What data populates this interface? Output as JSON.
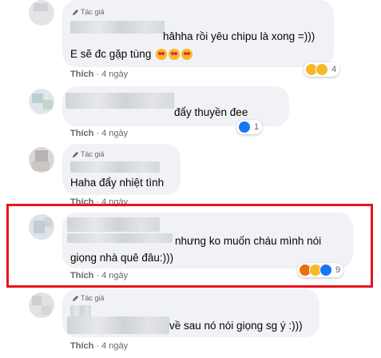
{
  "labels": {
    "author_badge": "Tác giả",
    "like_action": "Thích",
    "time_ago": "4 ngày"
  },
  "comments": [
    {
      "lines": [
        "hâhha rồi yêu chipu là xong =)))",
        "E sẽ đc gặp tùng"
      ],
      "author_badge": true,
      "reaction_count": "4",
      "reactions": [
        "wow",
        "love"
      ]
    },
    {
      "lines": [
        "đẩy thuyền đee"
      ],
      "author_badge": false,
      "reaction_count": "1",
      "reactions": [
        "like"
      ]
    },
    {
      "lines": [
        "Haha đẩy nhiệt tình"
      ],
      "author_badge": true,
      "reaction_count": "",
      "reactions": []
    },
    {
      "lines": [
        "nhưng ko muốn cháu mình nói",
        "giọng nhà quê đâu:)))"
      ],
      "author_badge": false,
      "reaction_count": "9",
      "reactions": [
        "angry",
        "wow",
        "like"
      ]
    },
    {
      "lines": [
        "về sau nó nói giọng sg ý :)))"
      ],
      "author_badge": true,
      "reaction_count": "",
      "reactions": []
    }
  ],
  "colors": {
    "highlight_border": "#e8141d",
    "bubble_bg": "#f0f2f5",
    "meta_text": "#65676b"
  },
  "icons": {
    "author_badge": "pencil-icon",
    "emoji_inline": "heart-eyes-emoji"
  }
}
